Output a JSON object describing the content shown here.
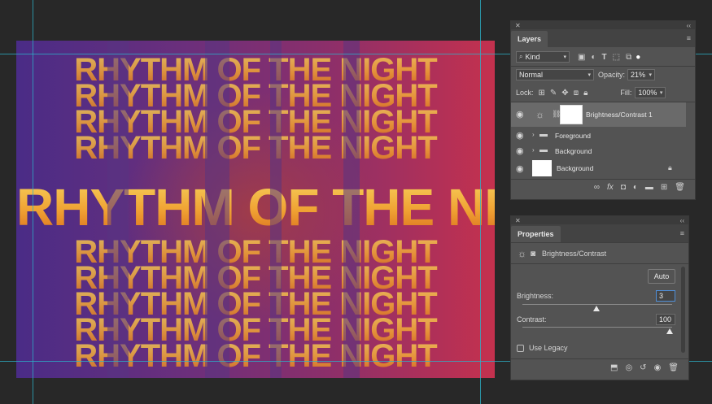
{
  "canvas": {
    "title_text": "RHYTHM OF THE NIGHT"
  },
  "layers_panel": {
    "tab": "Layers",
    "menu_icon": "hamburger-icon",
    "filter_kind": "Kind",
    "blend_mode": "Normal",
    "opacity_label": "Opacity:",
    "opacity_value": "21%",
    "lock_label": "Lock:",
    "fill_label": "Fill:",
    "fill_value": "100%",
    "layers": [
      {
        "name": "Brightness/Contrast 1",
        "type": "adjustment",
        "selected": true
      },
      {
        "name": "Foreground",
        "type": "group"
      },
      {
        "name": "Background",
        "type": "group"
      },
      {
        "name": "Background",
        "type": "layer",
        "locked": true
      }
    ],
    "footer_icons": [
      "link-icon",
      "fx-icon",
      "mask-icon",
      "adjustment-icon",
      "folder-icon",
      "new-layer-icon",
      "trash-icon"
    ]
  },
  "properties_panel": {
    "tab": "Properties",
    "adjustment_name": "Brightness/Contrast",
    "auto_label": "Auto",
    "brightness_label": "Brightness:",
    "brightness_value": "3",
    "contrast_label": "Contrast:",
    "contrast_value": "100",
    "legacy_label": "Use Legacy",
    "legacy_checked": false
  }
}
